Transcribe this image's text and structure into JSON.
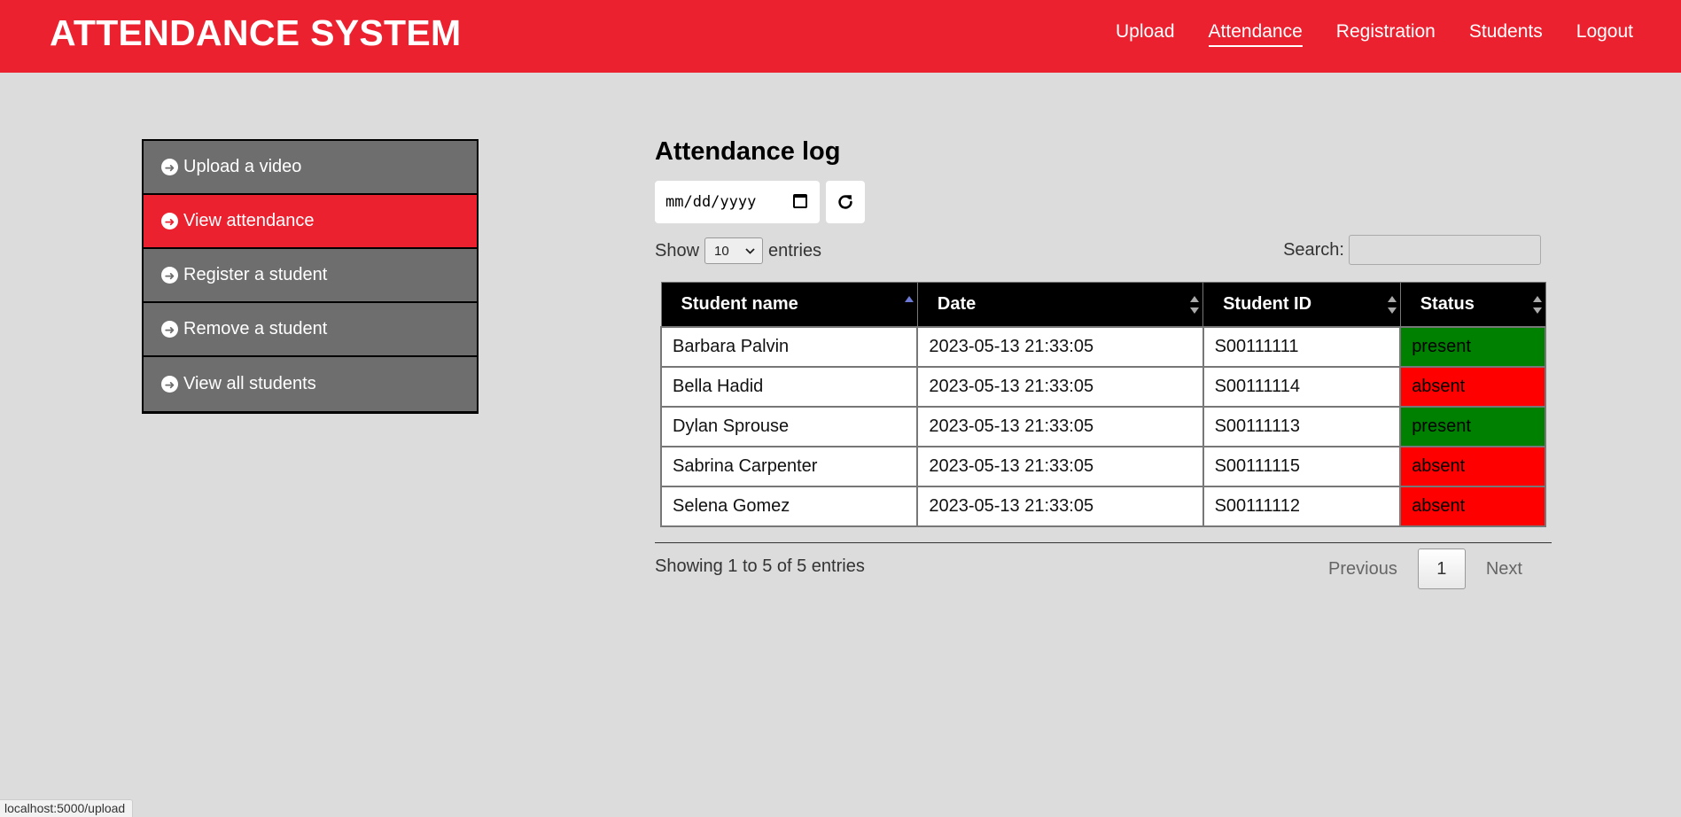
{
  "header": {
    "brand": "ATTENDANCE SYSTEM",
    "nav": [
      {
        "label": "Upload"
      },
      {
        "label": "Attendance",
        "active": true
      },
      {
        "label": "Registration"
      },
      {
        "label": "Students"
      },
      {
        "label": "Logout"
      }
    ]
  },
  "sidebar": {
    "items": [
      {
        "label": "Upload a video",
        "icon": "arrow-circle-right-icon"
      },
      {
        "label": "View attendance",
        "icon": "arrow-circle-right-icon",
        "active": true
      },
      {
        "label": "Register a student",
        "icon": "arrow-circle-right-icon"
      },
      {
        "label": "Remove a student",
        "icon": "arrow-circle-right-icon"
      },
      {
        "label": "View all students",
        "icon": "arrow-circle-right-icon"
      }
    ]
  },
  "main": {
    "title": "Attendance log",
    "date_placeholder": "mm/dd/yyyy",
    "length": {
      "show": "Show",
      "value": "10",
      "entries": "entries"
    },
    "search": {
      "label": "Search:",
      "value": ""
    },
    "table": {
      "columns": [
        "Student name",
        "Date",
        "Student ID",
        "Status"
      ],
      "rows": [
        {
          "name": "Barbara Palvin",
          "date": "2023-05-13 21:33:05",
          "id": "S00111111",
          "status": "present"
        },
        {
          "name": "Bella Hadid",
          "date": "2023-05-13 21:33:05",
          "id": "S00111114",
          "status": "absent"
        },
        {
          "name": "Dylan Sprouse",
          "date": "2023-05-13 21:33:05",
          "id": "S00111113",
          "status": "present"
        },
        {
          "name": "Sabrina Carpenter",
          "date": "2023-05-13 21:33:05",
          "id": "S00111115",
          "status": "absent"
        },
        {
          "name": "Selena Gomez",
          "date": "2023-05-13 21:33:05",
          "id": "S00111112",
          "status": "absent"
        }
      ]
    },
    "info": "Showing 1 to 5 of 5 entries",
    "pager": {
      "previous": "Previous",
      "page": "1",
      "next": "Next"
    }
  },
  "statusbar": {
    "url": "localhost:5000/upload"
  },
  "colors": {
    "brand_red": "#ec2130",
    "present": "#008000",
    "absent": "#ff0000",
    "sidebar_gray": "#6e6e6e"
  }
}
